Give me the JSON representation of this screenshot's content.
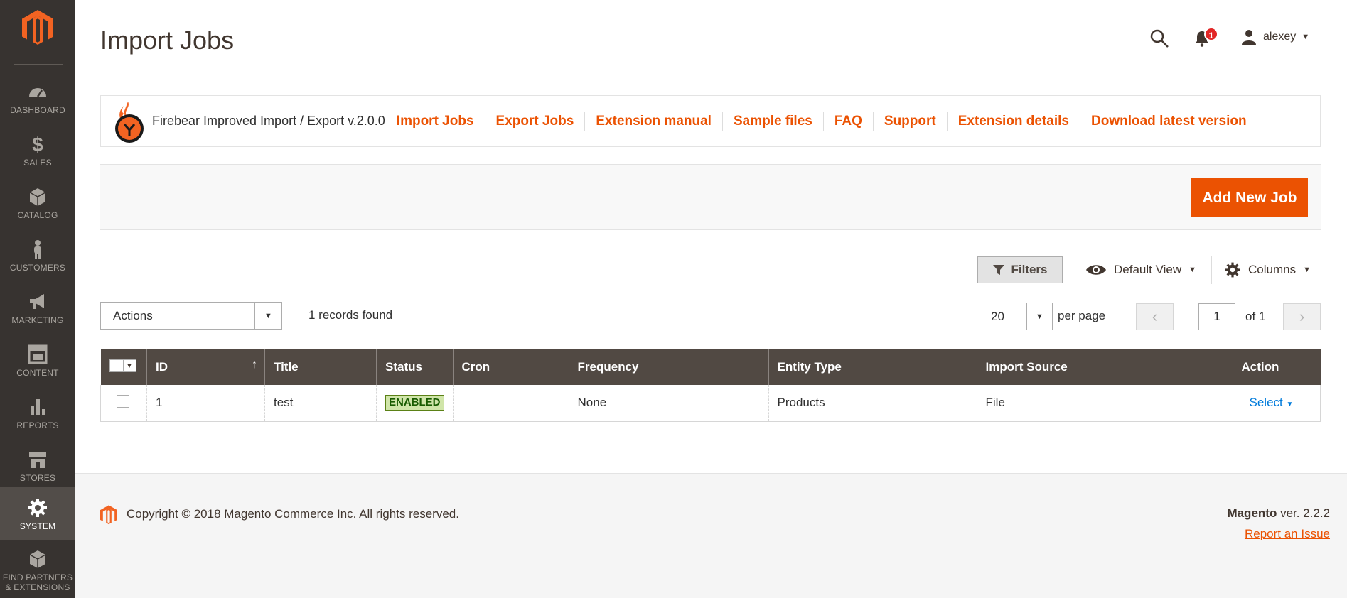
{
  "sidebar": {
    "items": [
      {
        "label": "Dashboard",
        "icon": "dashboard-icon"
      },
      {
        "label": "Sales",
        "icon": "dollar-icon"
      },
      {
        "label": "Catalog",
        "icon": "box-icon"
      },
      {
        "label": "Customers",
        "icon": "person-icon"
      },
      {
        "label": "Marketing",
        "icon": "megaphone-icon"
      },
      {
        "label": "Content",
        "icon": "layout-icon"
      },
      {
        "label": "Reports",
        "icon": "bar-chart-icon"
      },
      {
        "label": "Stores",
        "icon": "storefront-icon"
      },
      {
        "label": "System",
        "icon": "gear-icon",
        "active": true
      },
      {
        "label": "Find Partners",
        "label2": "& Extensions",
        "icon": "partners-box-icon"
      }
    ]
  },
  "header": {
    "title": "Import Jobs",
    "notifications_count": "1",
    "user_name": "alexey"
  },
  "extension_bar": {
    "name": "Firebear Improved Import / Export v.2.0.0",
    "links": [
      "Import Jobs",
      "Export Jobs",
      "Extension manual",
      "Sample files",
      "FAQ",
      "Support",
      "Extension details",
      "Download latest version"
    ]
  },
  "page_actions": {
    "add_button": "Add New Job"
  },
  "grid_controls": {
    "filters": "Filters",
    "view": "Default View",
    "columns": "Columns",
    "actions": "Actions",
    "records": "1 records found",
    "per_page_value": "20",
    "per_page_label": "per page",
    "page": "1",
    "of_pages": "of 1"
  },
  "table": {
    "columns": [
      "ID",
      "Title",
      "Status",
      "Cron",
      "Frequency",
      "Entity Type",
      "Import Source",
      "Action"
    ],
    "rows": [
      {
        "id": "1",
        "title": "test",
        "status": "ENABLED",
        "cron": "",
        "frequency": "None",
        "entity_type": "Products",
        "import_source": "File",
        "action": "Select"
      }
    ]
  },
  "footer": {
    "copyright": "Copyright © 2018 Magento Commerce Inc. All rights reserved.",
    "brand": "Magento",
    "version": "ver. 2.2.2",
    "report": "Report an Issue"
  },
  "colors": {
    "sidebar_bg": "#373330",
    "accent": "#eb5202",
    "table_header": "#514943",
    "link_blue": "#007bdb"
  }
}
